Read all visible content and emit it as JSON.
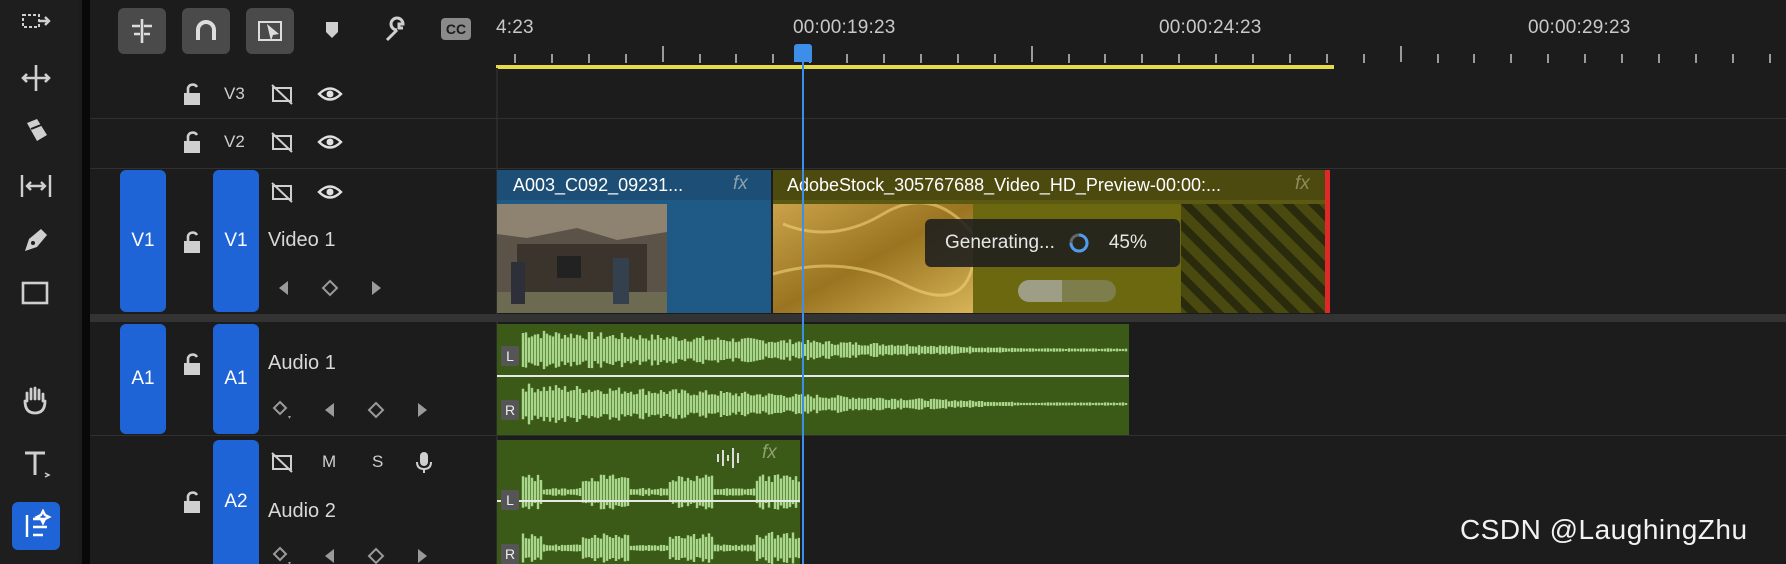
{
  "toolbar": {
    "tools": [
      {
        "name": "track-select-forward",
        "icon": "track-select-icon"
      },
      {
        "name": "ripple-edit",
        "icon": "ripple-edit-icon"
      },
      {
        "name": "razor",
        "icon": "razor-icon"
      },
      {
        "name": "slip",
        "icon": "slip-icon"
      },
      {
        "name": "pen",
        "icon": "pen-icon"
      },
      {
        "name": "rectangle",
        "icon": "rectangle-icon"
      },
      {
        "name": "hand",
        "icon": "hand-icon"
      },
      {
        "name": "type",
        "icon": "type-icon"
      },
      {
        "name": "generative-extend",
        "icon": "generative-extend-icon",
        "active": true
      }
    ]
  },
  "header": {
    "buttons": [
      "insert-sequence-icon",
      "snap-magnet-icon",
      "linked-selection-icon"
    ],
    "icons": [
      "marker-icon",
      "wrench-icon"
    ],
    "cc_label": "CC"
  },
  "ruler": {
    "timecodes": [
      "4:23",
      "00:00:19:23",
      "00:00:24:23",
      "00:00:29:23"
    ]
  },
  "tracks": {
    "v3": {
      "label": "V3"
    },
    "v2": {
      "label": "V2"
    },
    "v1": {
      "target": "V1",
      "label": "V1",
      "name": "Video 1"
    },
    "a1": {
      "target": "A1",
      "label": "A1",
      "name": "Audio 1"
    },
    "a2": {
      "label": "A2",
      "name": "Audio 2",
      "m": "M",
      "s": "S"
    }
  },
  "clips": {
    "video1": {
      "title": "A003_C092_09231...",
      "fx": "fx"
    },
    "video2": {
      "title": "AdobeStock_305767688_Video_HD_Preview-00:00:...",
      "fx": "fx"
    },
    "audio1": {
      "left_channel": "L",
      "right_channel": "R"
    },
    "audio2": {
      "left_channel": "L",
      "right_channel": "R",
      "fx": "fx"
    }
  },
  "generating": {
    "label": "Generating...",
    "percent": "45%",
    "progress": 0.45
  },
  "colors": {
    "accent": "#1e64d6",
    "video_clip": "#1f5a86",
    "generated_clip": "#5c5a12",
    "audio_clip": "#3b5a17",
    "waveform": "#a8d68a",
    "playhead": "#3d8ee8",
    "work_area": "#e6d94a"
  },
  "watermark": "CSDN @LaughingZhu"
}
